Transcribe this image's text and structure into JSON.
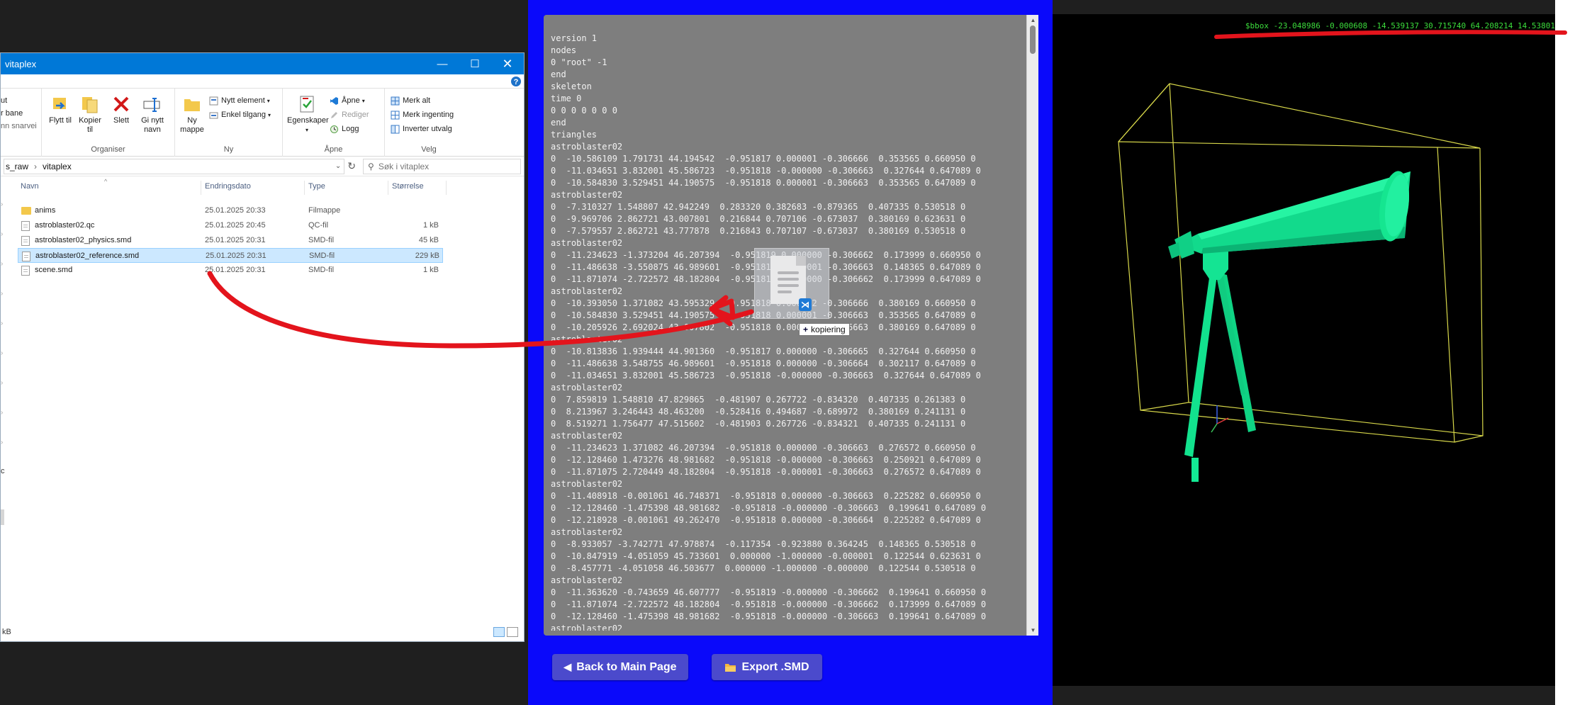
{
  "explorer": {
    "title": "vitaplex",
    "window_controls": {
      "minimize": "—",
      "maximize": "☐",
      "close": "✕"
    },
    "ribbon": {
      "left_stub": [
        "ut",
        "r bane",
        "nn snarvei"
      ],
      "organize": {
        "label": "Organiser",
        "move": "Flytt til",
        "copy": "Kopier til",
        "delete": "Slett",
        "rename": "Gi nytt navn"
      },
      "new": {
        "label": "Ny",
        "new_folder": "Ny mappe",
        "new_item": "Nytt element",
        "easy_access": "Enkel tilgang"
      },
      "open": {
        "label": "Åpne",
        "properties": "Egenskaper",
        "open": "Åpne",
        "edit": "Rediger",
        "history": "Logg"
      },
      "select": {
        "label": "Velg",
        "select_all": "Merk alt",
        "select_none": "Merk ingenting",
        "invert": "Inverter utvalg"
      }
    },
    "address": {
      "parent": "s_raw",
      "current": "vitaplex"
    },
    "search": {
      "placeholder": "Søk i vitaplex"
    },
    "columns": {
      "name": "Navn",
      "date": "Endringsdato",
      "type": "Type",
      "size": "Størrelse"
    },
    "files": [
      {
        "name": "anims",
        "date": "25.01.2025 20:33",
        "type": "Filmappe",
        "size": "",
        "icon": "folder-icon",
        "selected": false
      },
      {
        "name": "astroblaster02.qc",
        "date": "25.01.2025 20:45",
        "type": "QC-fil",
        "size": "1 kB",
        "icon": "file-icon",
        "selected": false
      },
      {
        "name": "astroblaster02_physics.smd",
        "date": "25.01.2025 20:31",
        "type": "SMD-fil",
        "size": "45 kB",
        "icon": "file-icon",
        "selected": false
      },
      {
        "name": "astroblaster02_reference.smd",
        "date": "25.01.2025 20:31",
        "type": "SMD-fil",
        "size": "229 kB",
        "icon": "file-icon",
        "selected": true
      },
      {
        "name": "scene.smd",
        "date": "25.01.2025 20:31",
        "type": "SMD-fil",
        "size": "1 kB",
        "icon": "file-icon",
        "selected": false
      }
    ],
    "status": "kB",
    "nav_stub": "c"
  },
  "smd_panel": {
    "lines": [
      "version 1",
      "nodes",
      "0 \"root\" -1",
      "end",
      "skeleton",
      "time 0",
      "0 0 0 0 0 0 0",
      "end",
      "triangles",
      "astroblaster02",
      "0  -10.586109 1.791731 44.194542  -0.951817 0.000001 -0.306666  0.353565 0.660950 0",
      "0  -11.034651 3.832001 45.586723  -0.951818 -0.000000 -0.306663  0.327644 0.647089 0",
      "0  -10.584830 3.529451 44.190575  -0.951818 0.000001 -0.306663  0.353565 0.647089 0",
      "astroblaster02",
      "0  -7.310327 1.548807 42.942249  0.283320 0.382683 -0.879365  0.407335 0.530518 0",
      "0  -9.969706 2.862721 43.007801  0.216844 0.707106 -0.673037  0.380169 0.623631 0",
      "0  -7.579557 2.862721 43.777878  0.216843 0.707107 -0.673037  0.380169 0.530518 0",
      "astroblaster02",
      "0  -11.234623 -1.373204 46.207394  -0.951819 0.000000 -0.306662  0.173999 0.660950 0",
      "0  -11.486638 -3.550875 46.989601  -0.951818 0.000001 -0.306663  0.148365 0.647089 0",
      "0  -11.871074 -2.722572 48.182804  -0.951818 0.000000 -0.306662  0.173999 0.647089 0",
      "astroblaster02",
      "0  -10.393050 1.371082 43.595329  -0.951818 0.000002 -0.306666  0.380169 0.660950 0",
      "0  -10.584830 3.529451 44.190575  -0.951818 0.000001 -0.306663  0.353565 0.647089 0",
      "0  -10.205926 2.692024 43.007802  -0.951818 0.000001 -0.306663  0.380169 0.647089 0",
      "astroblaster02",
      "0  -10.813836 1.939444 44.901360  -0.951817 0.000000 -0.306665  0.327644 0.660950 0",
      "0  -11.486638 3.548755 46.989601  -0.951818 0.000000 -0.306664  0.302117 0.647089 0",
      "0  -11.034651 3.832001 45.586723  -0.951818 -0.000000 -0.306663  0.327644 0.647089 0",
      "astroblaster02",
      "0  7.859819 1.548810 47.829865  -0.481907 0.267722 -0.834320  0.407335 0.261383 0",
      "0  8.213967 3.246443 48.463200  -0.528416 0.494687 -0.689972  0.380169 0.241131 0",
      "0  8.519271 1.756477 47.515602  -0.481903 0.267726 -0.834321  0.407335 0.241131 0",
      "astroblaster02",
      "0  -11.234623 1.371082 46.207394  -0.951818 0.000000 -0.306663  0.276572 0.660950 0",
      "0  -12.128460 1.473276 48.981682  -0.951818 -0.000000 -0.306663  0.250921 0.647089 0",
      "0  -11.871075 2.720449 48.182804  -0.951818 -0.000001 -0.306663  0.276572 0.647089 0",
      "astroblaster02",
      "0  -11.408918 -0.001061 46.748371  -0.951818 0.000000 -0.306663  0.225282 0.660950 0",
      "0  -12.128460 -1.475398 48.981682  -0.951818 -0.000000 -0.306663  0.199641 0.647089 0",
      "0  -12.218928 -0.001061 49.262470  -0.951818 0.000000 -0.306664  0.225282 0.647089 0",
      "astroblaster02",
      "0  -8.933057 -3.742771 47.978874  -0.117354 -0.923880 0.364245  0.148365 0.530518 0",
      "0  -10.847919 -4.051059 45.733601  0.000000 -1.000000 -0.000001  0.122544 0.623631 0",
      "0  -8.457771 -4.051058 46.503677  0.000000 -1.000000 -0.000000  0.122544 0.530518 0",
      "astroblaster02",
      "0  -11.363620 -0.743659 46.607777  -0.951819 -0.000000 -0.306662  0.199641 0.660950 0",
      "0  -11.871074 -2.722572 48.182804  -0.951818 -0.000000 -0.306662  0.173999 0.647089 0",
      "0  -12.128460 -1.475398 48.981682  -0.951818 -0.000000 -0.306663  0.199641 0.647089 0",
      "astroblaster02"
    ],
    "back_button": "Back to Main Page",
    "back_icon": "◀",
    "export_button": "Export .SMD",
    "export_icon": "folder-icon"
  },
  "drag": {
    "badge_text": "kopiering",
    "badge_icon": "+"
  },
  "viewer": {
    "bbox_text": "$bbox -23.048986 -0.000608 -14.539137 30.715740 64.208214 14.53801",
    "model_color": "#00e890",
    "bbox_color": "#d8d84a"
  },
  "colors": {
    "panel_blue": "#0a09fa",
    "button_blue": "#4b4acc",
    "annotation_red": "#e3141c",
    "titlebar_blue": "#0078d7"
  }
}
